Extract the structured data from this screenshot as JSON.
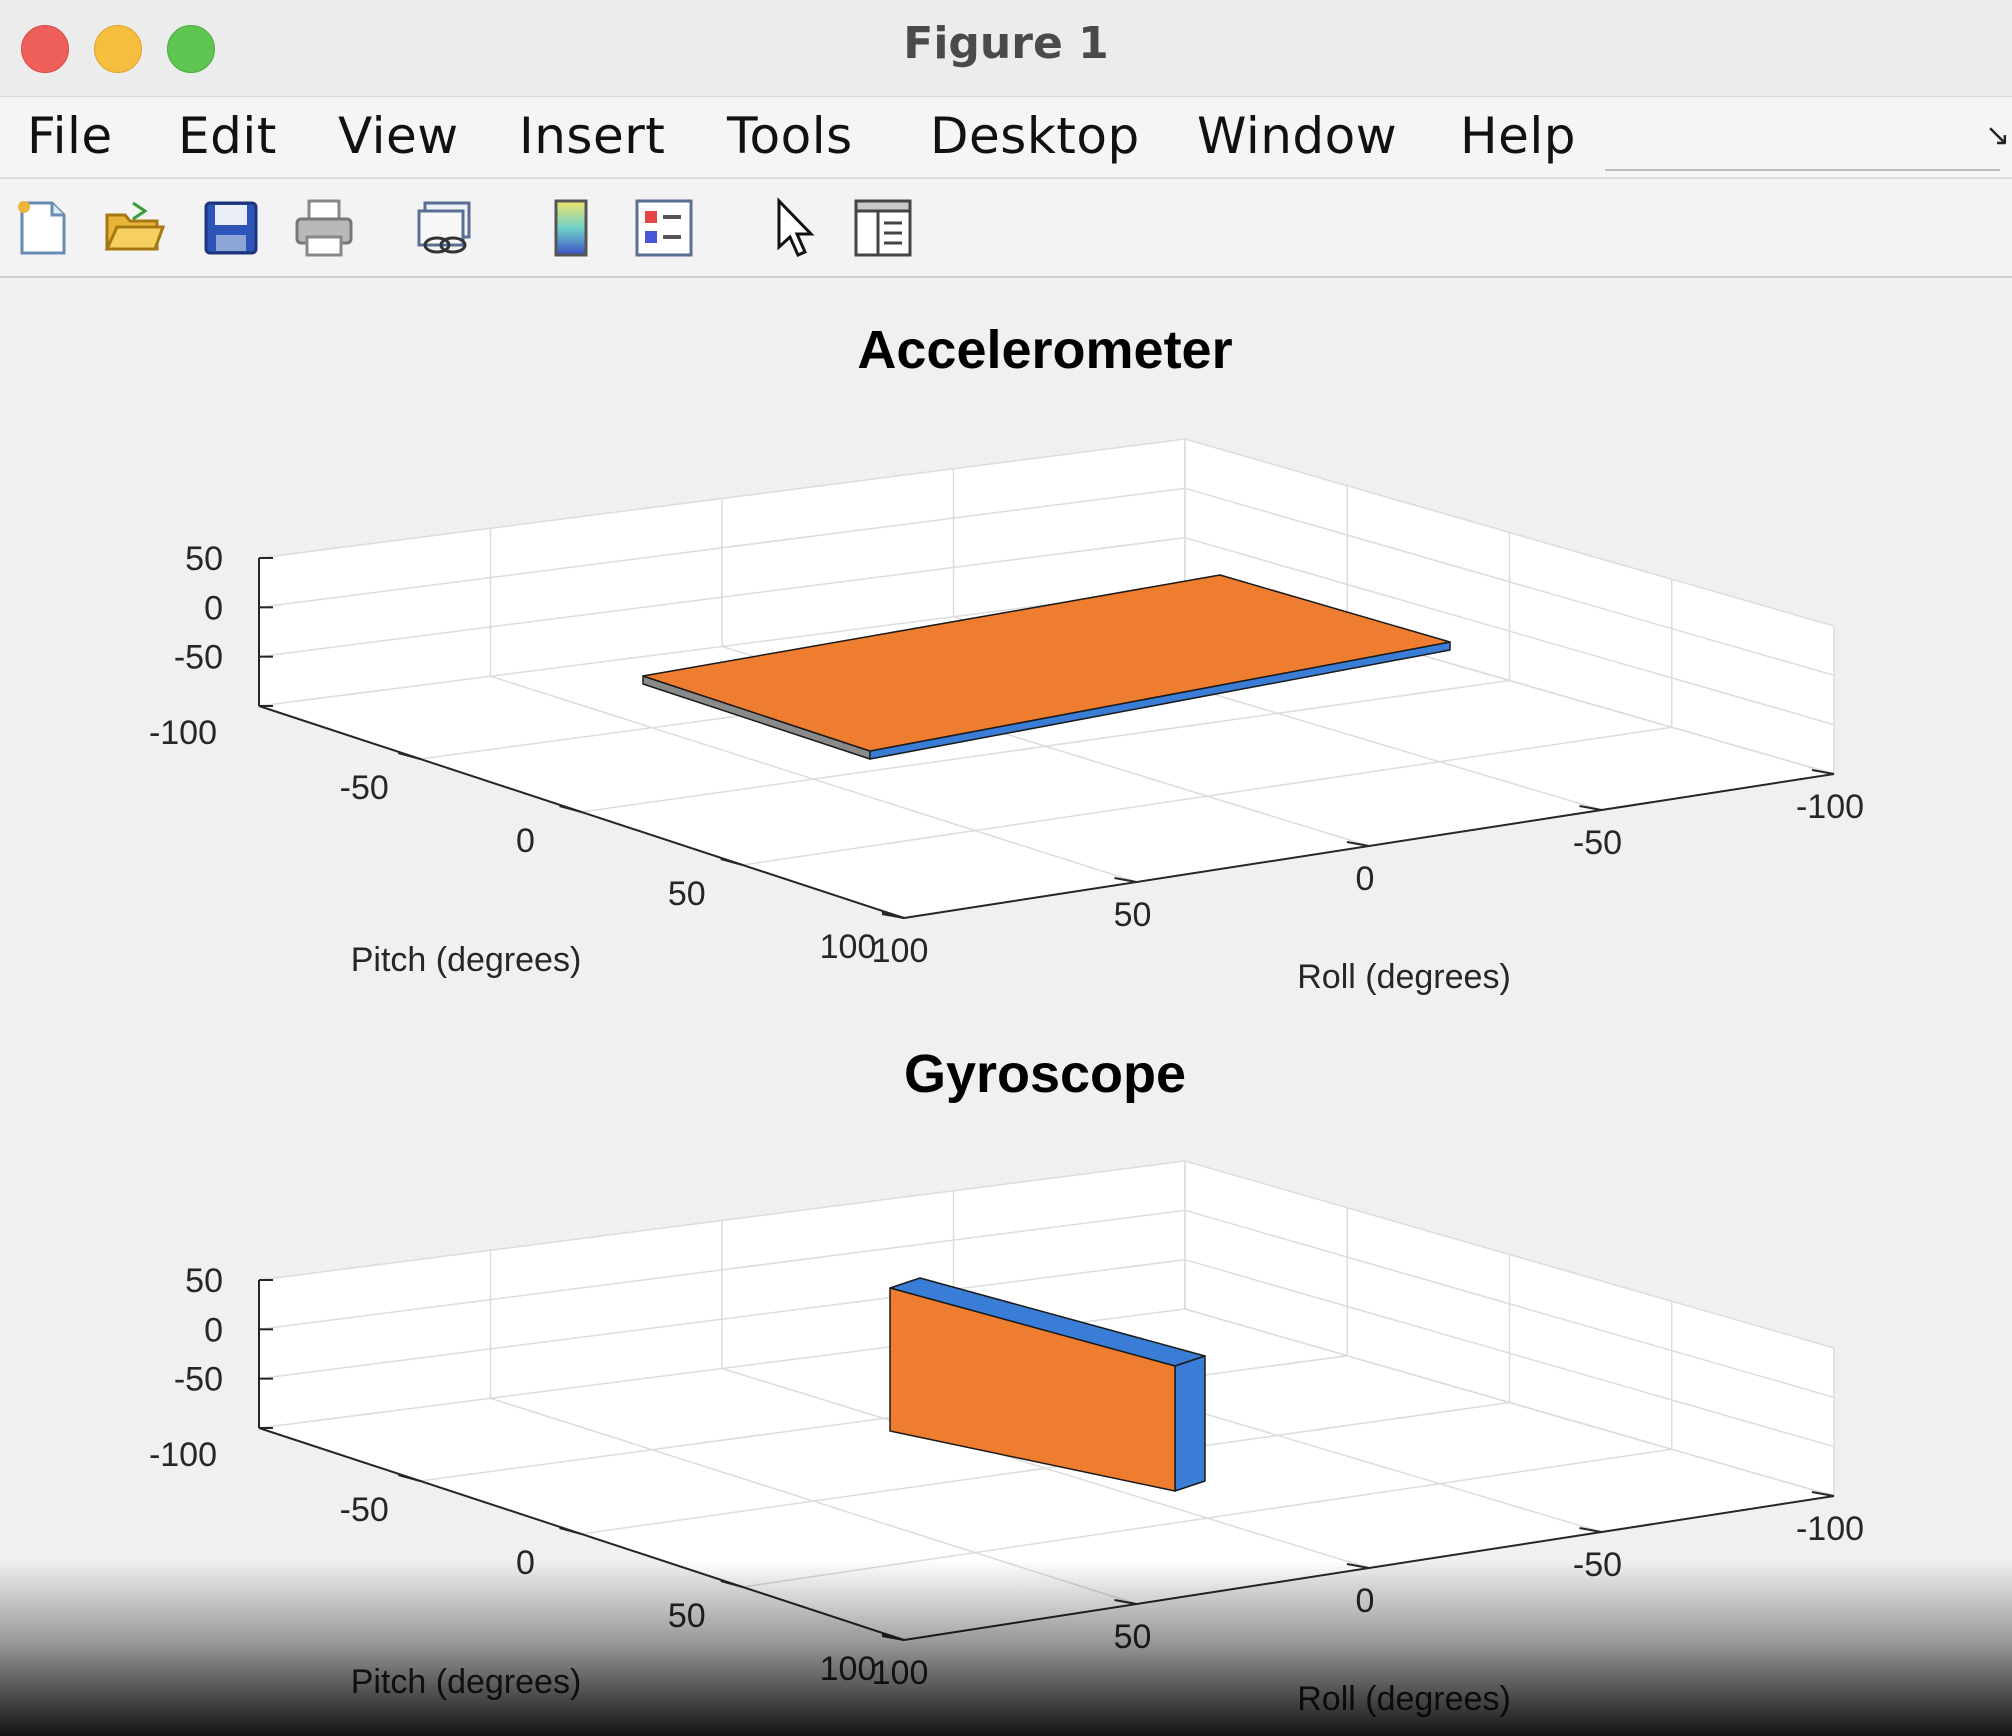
{
  "window": {
    "title": "Figure 1"
  },
  "menu": {
    "items": [
      "File",
      "Edit",
      "View",
      "Insert",
      "Tools",
      "Desktop",
      "Window",
      "Help"
    ]
  },
  "toolbar": {
    "buttons": [
      "new-figure-icon",
      "open-file-icon",
      "save-icon",
      "print-icon",
      "link-plot-icon",
      "colorbar-icon",
      "legend-icon",
      "pointer-icon",
      "property-inspector-icon"
    ]
  },
  "colors": {
    "face_top": "#ee7d30",
    "face_side": "#3a7dd6",
    "face_back": "#8a8a8a"
  },
  "chart_data": [
    {
      "type": "3d-box",
      "title": "Accelerometer",
      "xlabel": "Roll (degrees)",
      "ylabel": "Pitch (degrees)",
      "zlabel": "",
      "xticks": [
        "-100",
        "-50",
        "0",
        "50",
        "100"
      ],
      "yticks": [
        "-50",
        "0",
        "50",
        "100"
      ],
      "zticks": [
        "50",
        "0",
        "-50",
        "-100"
      ],
      "xlim": [
        -100,
        100
      ],
      "ylim": [
        -100,
        100
      ],
      "zlim": [
        -100,
        50
      ],
      "grid": true
    },
    {
      "type": "3d-box",
      "title": "Gyroscope",
      "xlabel": "Roll (degrees)",
      "ylabel": "Pitch (degrees)",
      "zlabel": "",
      "xticks": [
        "-100",
        "-50",
        "0",
        "50",
        "100"
      ],
      "yticks": [
        "-50",
        "0",
        "50",
        "100"
      ],
      "zticks": [
        "50",
        "0",
        "-50",
        "-100"
      ],
      "xlim": [
        -100,
        100
      ],
      "ylim": [
        -100,
        100
      ],
      "zlim": [
        -100,
        50
      ],
      "grid": true
    }
  ]
}
